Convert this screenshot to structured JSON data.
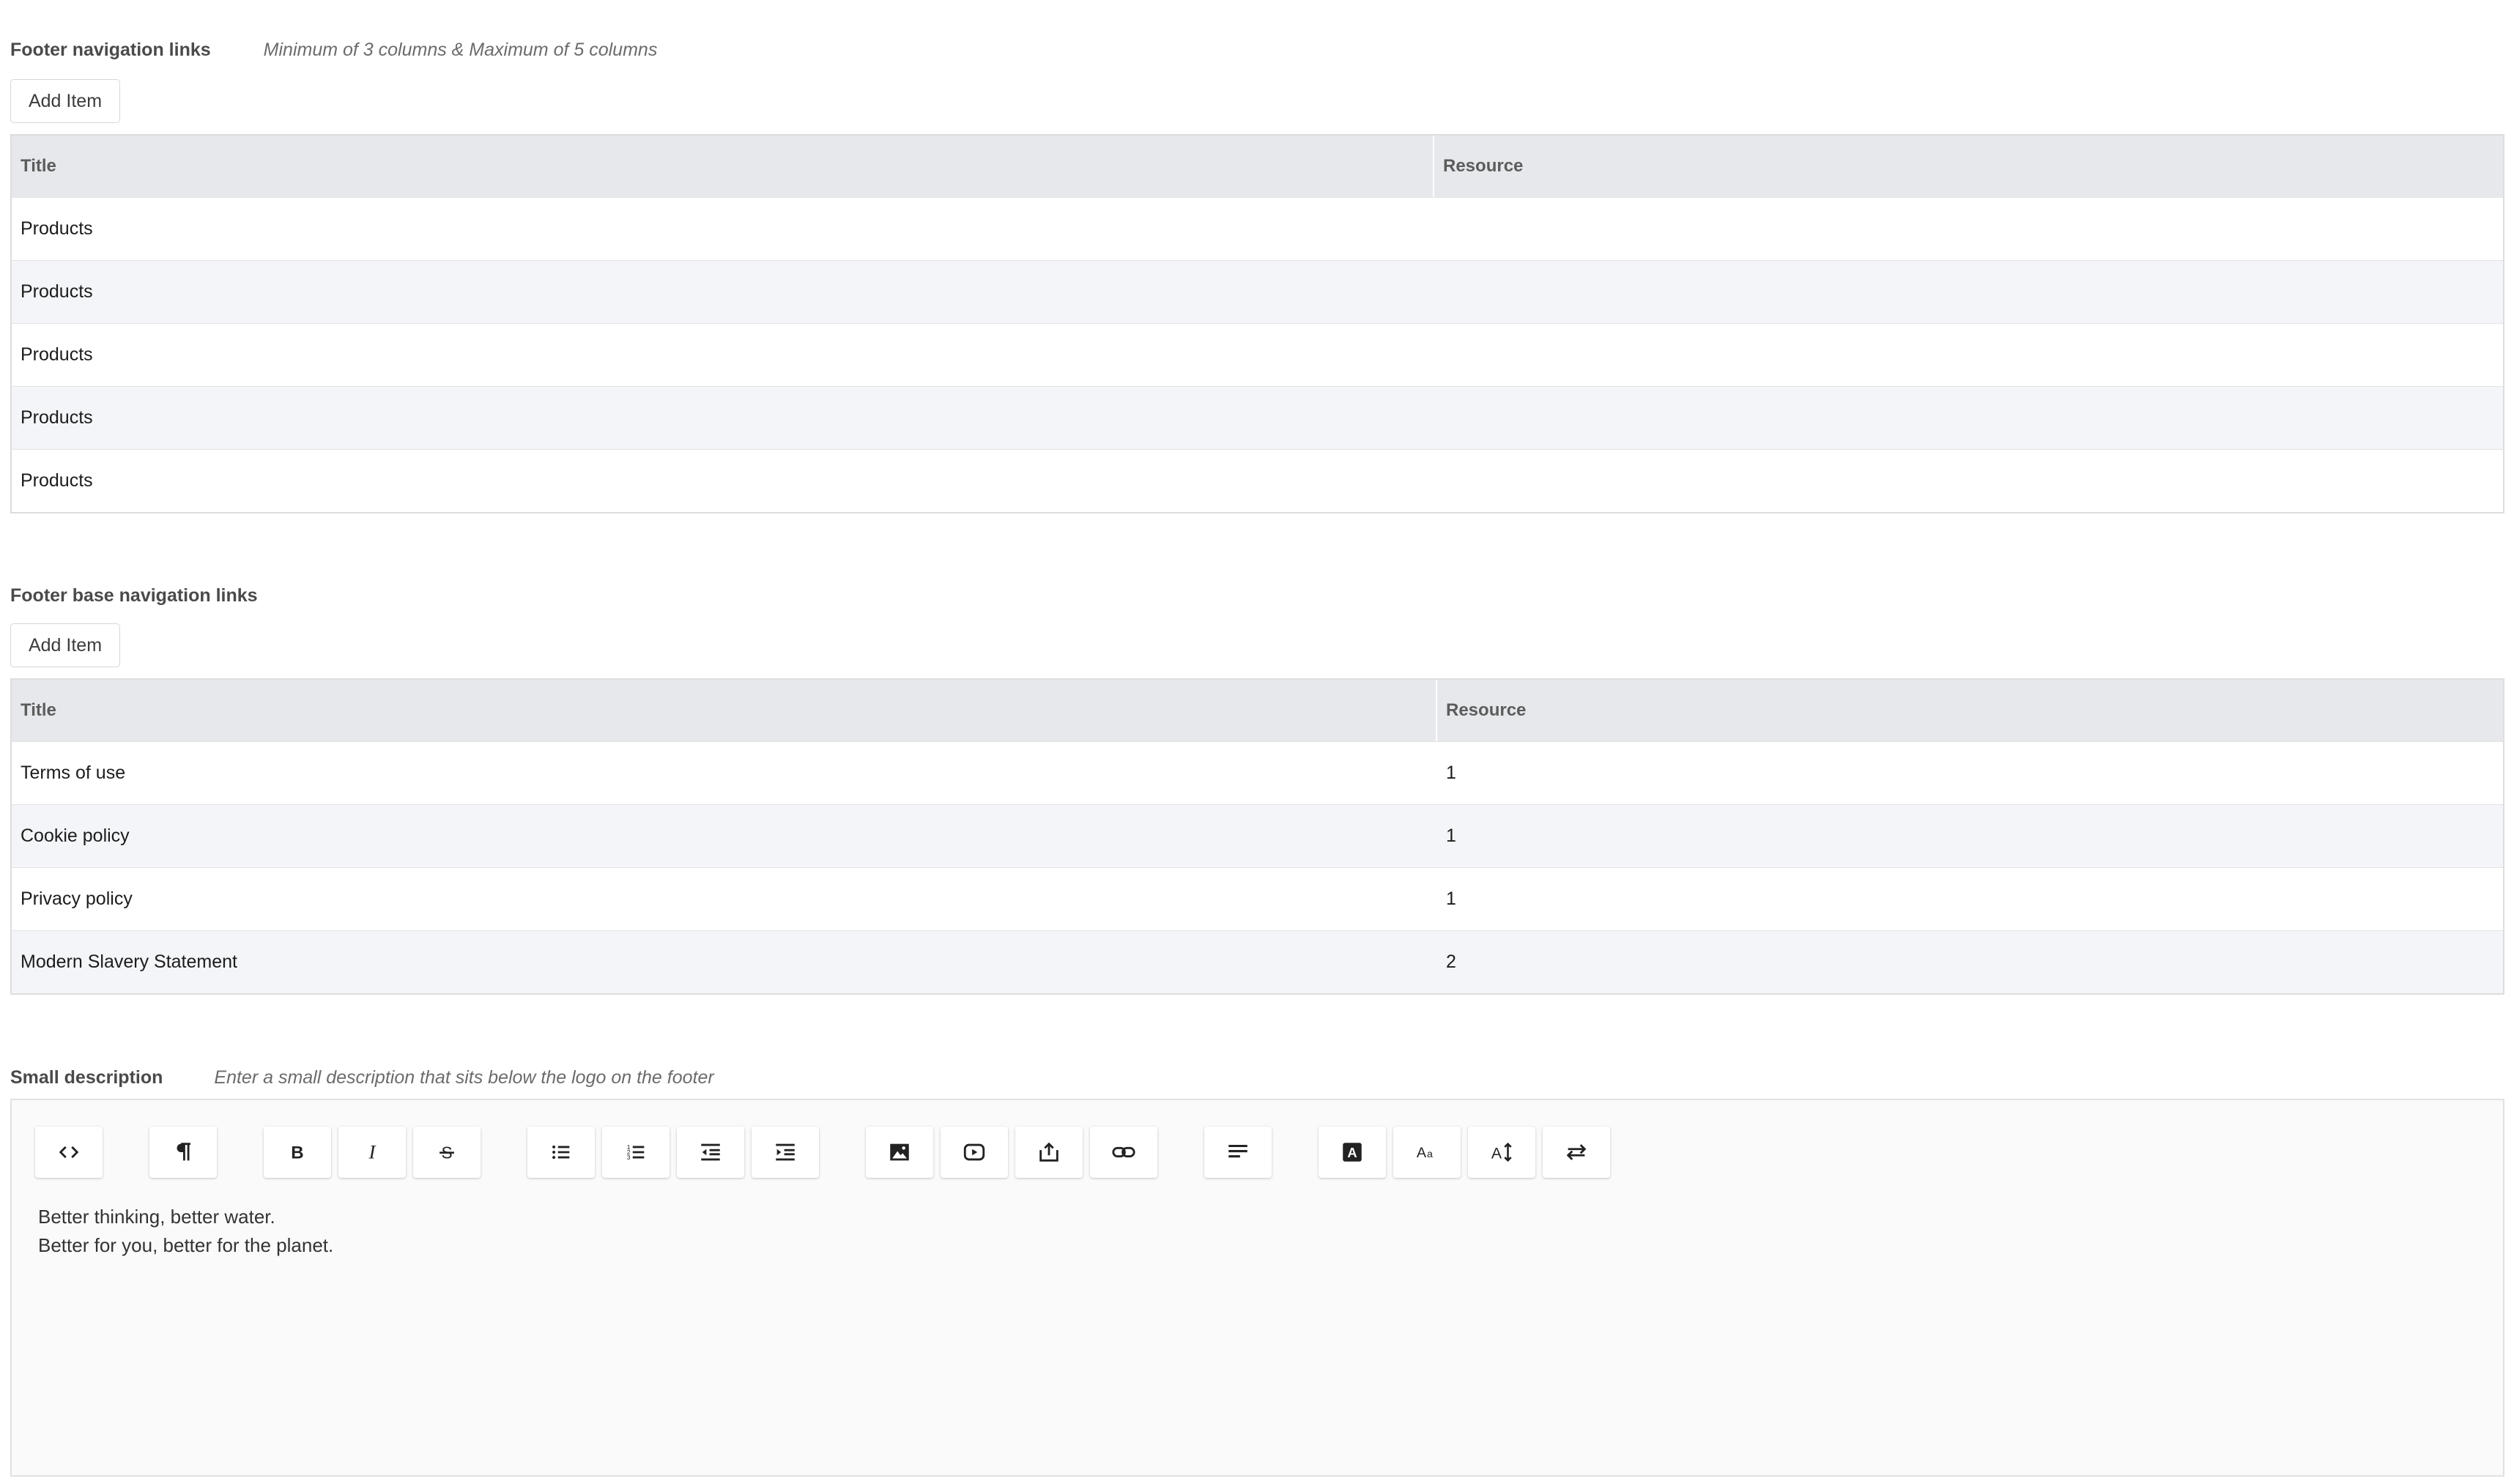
{
  "nav_links": {
    "title": "Footer navigation links",
    "hint": "Minimum of 3 columns & Maximum of 5 columns",
    "add_label": "Add Item",
    "columns": [
      "Title",
      "Resource"
    ],
    "rows": [
      {
        "title": "Products",
        "resource": ""
      },
      {
        "title": "Products",
        "resource": ""
      },
      {
        "title": "Products",
        "resource": ""
      },
      {
        "title": "Products",
        "resource": ""
      },
      {
        "title": "Products",
        "resource": ""
      }
    ]
  },
  "base_links": {
    "title": "Footer base navigation links",
    "add_label": "Add Item",
    "columns": [
      "Title",
      "Resource"
    ],
    "rows": [
      {
        "title": "Terms of use",
        "resource": "1"
      },
      {
        "title": "Cookie policy",
        "resource": "1"
      },
      {
        "title": "Privacy policy",
        "resource": "1"
      },
      {
        "title": "Modern Slavery Statement",
        "resource": "2"
      }
    ]
  },
  "description": {
    "title": "Small description",
    "hint": "Enter a small description that sits below the logo on the footer",
    "toolbar": [
      "code-view-icon",
      "paragraph-icon",
      "bold-icon",
      "italic-icon",
      "strikethrough-icon",
      "bullet-list-icon",
      "numbered-list-icon",
      "outdent-icon",
      "indent-icon",
      "image-icon",
      "video-icon",
      "embed-icon",
      "link-icon",
      "align-icon",
      "text-color-icon",
      "font-size-icon",
      "line-height-icon",
      "text-direction-icon"
    ],
    "lines": [
      "Better thinking, better water.",
      "Better for you, better for the planet."
    ]
  }
}
